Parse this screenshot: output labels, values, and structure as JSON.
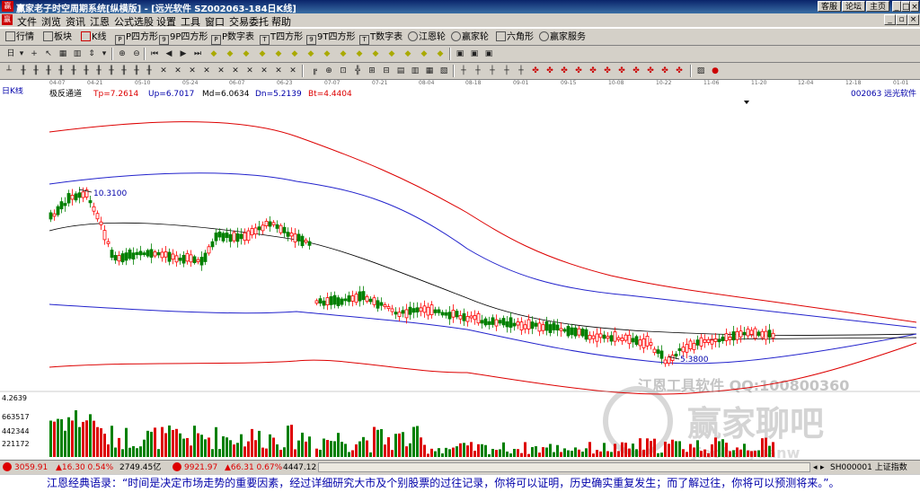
{
  "window": {
    "title": "赢家老子时空周期系统[纵横版] - [远光软件  SZ002063-184日K线]",
    "icon": "赢",
    "right_buttons": [
      "客服",
      "论坛",
      "主页"
    ]
  },
  "menu": {
    "icon": "赢",
    "items": [
      "文件",
      "浏览",
      "资讯",
      "江恩",
      "公式选股",
      "设置",
      "工具",
      "窗口",
      "交易委托",
      "帮助"
    ]
  },
  "toolbar1": [
    {
      "name": "quotes",
      "label": "行情"
    },
    {
      "name": "sector",
      "label": "板块"
    },
    {
      "name": "kline",
      "label": "K线"
    },
    {
      "name": "p-square",
      "label": "P四方形"
    },
    {
      "name": "9p-square",
      "label": "9P四方形"
    },
    {
      "name": "p-number",
      "label": "P数字表"
    },
    {
      "name": "t-square",
      "label": "T四方形"
    },
    {
      "name": "9t-square",
      "label": "9T四方形"
    },
    {
      "name": "t-number",
      "label": "T数字表"
    },
    {
      "name": "gann-wheel",
      "label": "江恩轮"
    },
    {
      "name": "winner-wheel",
      "label": "赢家轮"
    },
    {
      "name": "hexagon",
      "label": "六角形"
    },
    {
      "name": "winner-service",
      "label": "赢家服务"
    }
  ],
  "chart": {
    "period_label": "日K线",
    "indicator": {
      "name": "极反通道",
      "tp": "Tp=7.2614",
      "up": "Up=6.7017",
      "md": "Md=6.0634",
      "dn": "Dn=5.2139",
      "bt": "Bt=4.4404"
    },
    "stock": {
      "code": "002063",
      "name": "远光软件"
    },
    "high_label": "10.3100",
    "low_label": "5.3800",
    "volume_axis": [
      "4.2639",
      "663517",
      "442344",
      "221172"
    ],
    "date_ticks": [
      "04-07",
      "04-21",
      "05-10",
      "05-24",
      "06-07",
      "06-23",
      "07-07",
      "07-21",
      "08-04",
      "08-18",
      "09-01",
      "09-15",
      "10-08",
      "10-22",
      "11-06",
      "11-20",
      "12-04",
      "12-18",
      "01-01"
    ],
    "colors": {
      "up": "#ff0000",
      "down": "#008000",
      "top_band": "#dd0000",
      "upper_band": "#0000cc",
      "mid": "#000000",
      "volume_up": "#dd0000",
      "volume_down": "#008000"
    }
  },
  "watermark": {
    "line1": "江恩工具软件  QQ:100800360",
    "brand": "赢家聊吧",
    "sub": "Jiaoba.yuanw"
  },
  "ticker": {
    "sh_index": "3059.91",
    "sh_change": "▲16.30 0.54%",
    "sh_amount": "2749.45亿",
    "sz_index": "9921.97",
    "sz_change": "▲66.31 0.67%",
    "sz_amount": "4447.12",
    "right": "SH000001 上证指数"
  },
  "status_quote": "江恩经典语录：“时间是决定市场走势的重要因素，经过详细研究大市及个别股票的过往记录，你将可以证明，历史确实重复发生；而了解过往，你将可以预测将来。”。"
}
